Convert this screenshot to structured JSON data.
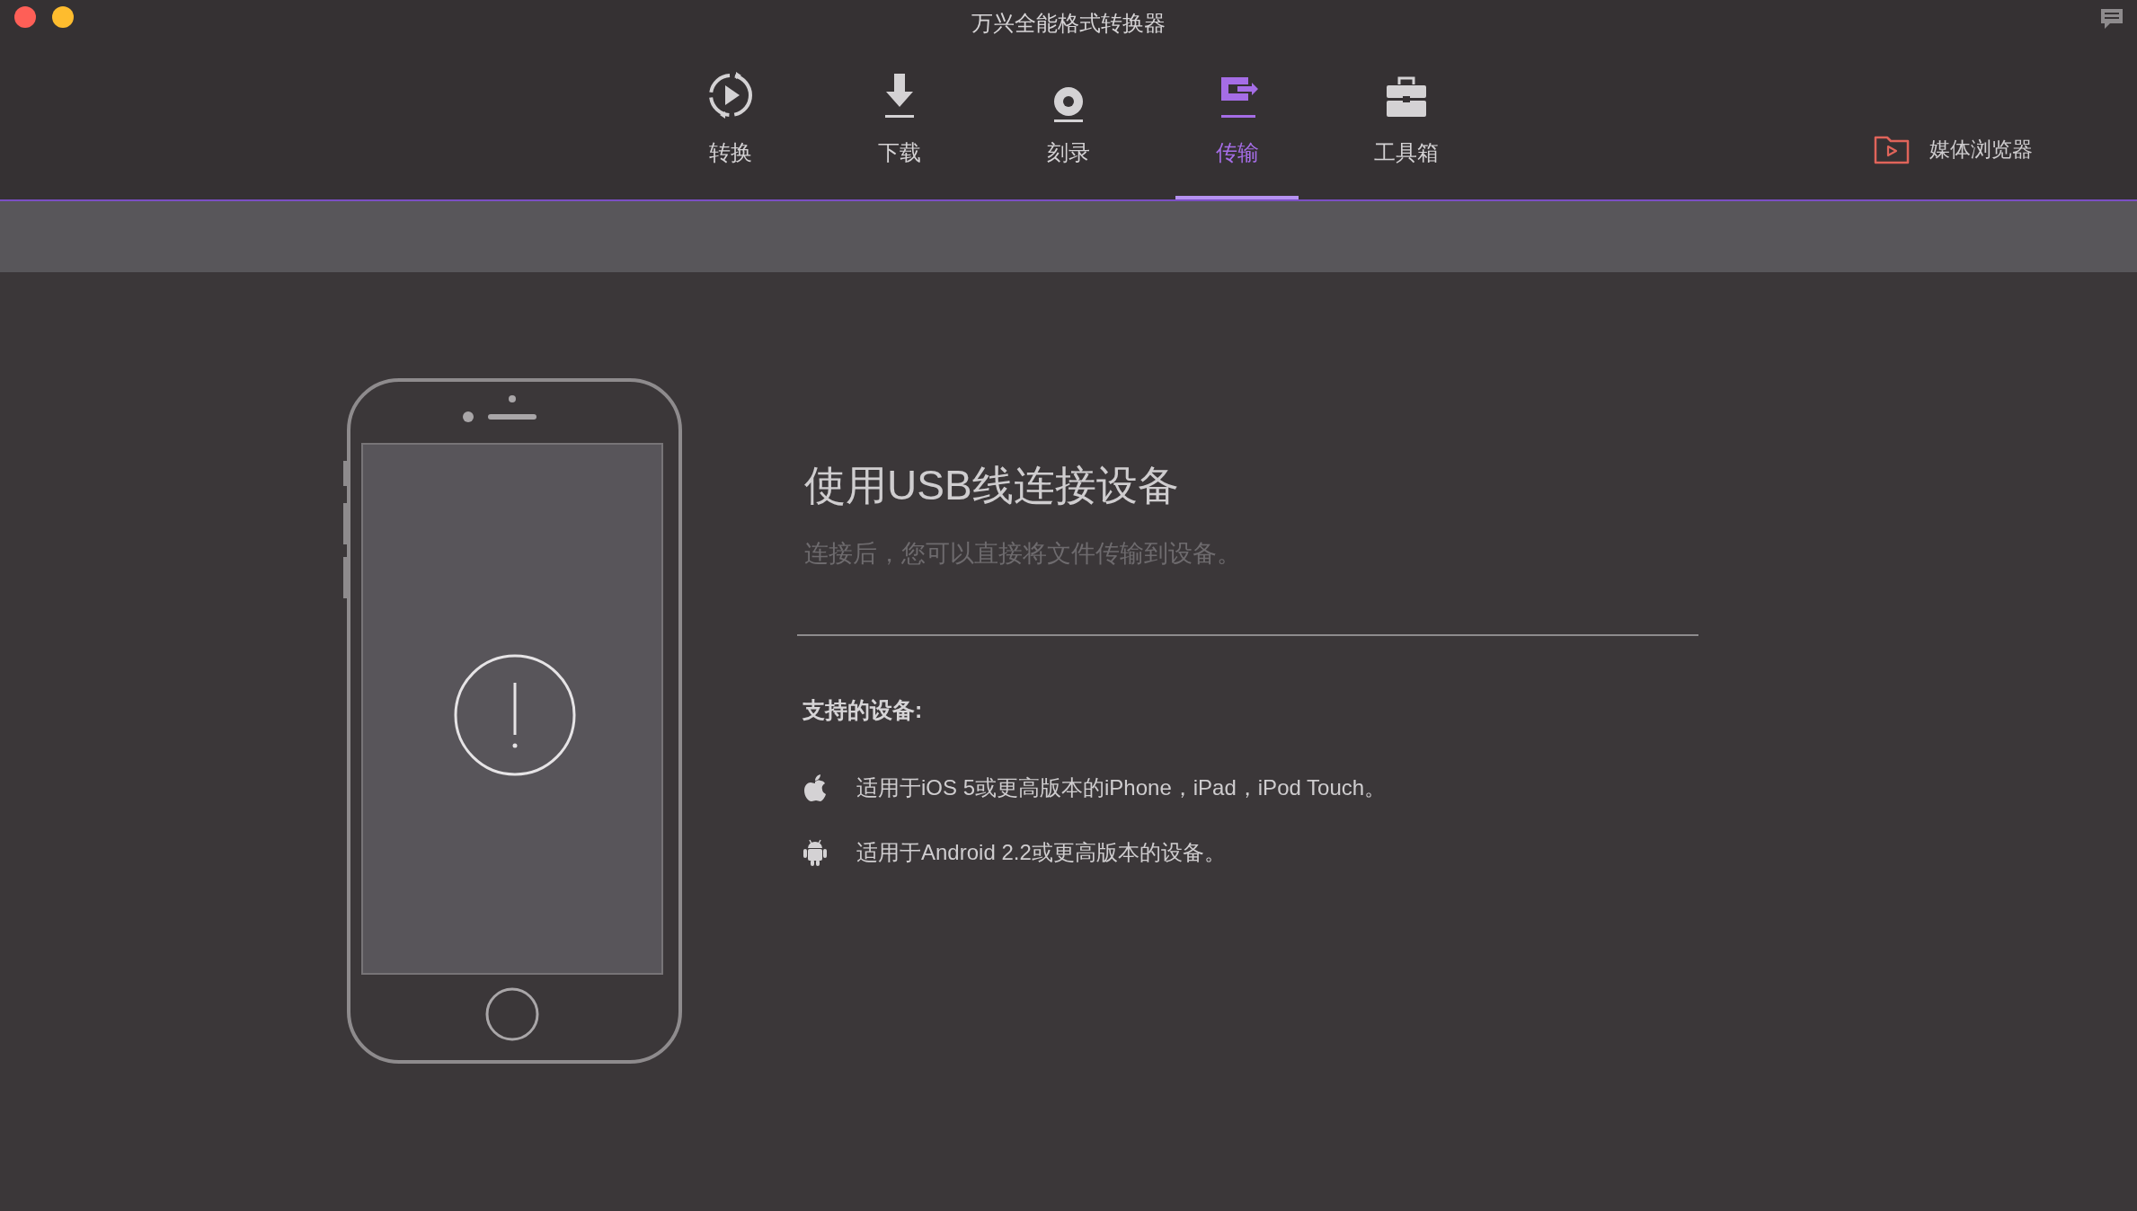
{
  "window": {
    "title": "万兴全能格式转换器"
  },
  "tabs": [
    {
      "label": "转换",
      "kind": "convert",
      "selected": false
    },
    {
      "label": "下载",
      "kind": "download",
      "selected": false
    },
    {
      "label": "刻录",
      "kind": "burn",
      "selected": false
    },
    {
      "label": "传输",
      "kind": "transfer",
      "selected": true
    },
    {
      "label": "工具箱",
      "kind": "toolbox",
      "selected": false
    }
  ],
  "media_browser": {
    "label": "媒体浏览器"
  },
  "connect_panel": {
    "heading": "使用USB线连接设备",
    "subtitle": "连接后，您可以直接将文件传输到设备。",
    "supported_title": "支持的设备:",
    "devices": [
      {
        "kind": "apple",
        "text": "适用于iOS 5或更高版本的iPhone，iPad，iPod Touch。"
      },
      {
        "kind": "android",
        "text": "适用于Android 2.2或更高版本的设备。"
      }
    ]
  }
}
